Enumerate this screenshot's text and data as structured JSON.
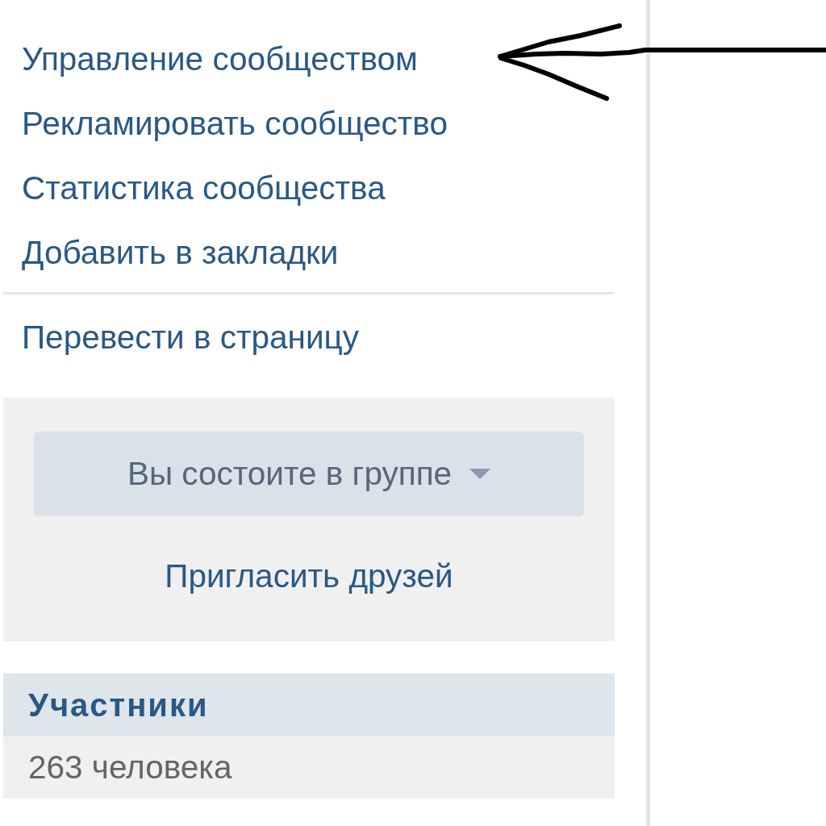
{
  "menu_groups": [
    {
      "items": [
        {
          "label": "Управление сообществом",
          "pointed": true
        },
        {
          "label": "Рекламировать сообщество",
          "pointed": false
        },
        {
          "label": "Статистика сообщества",
          "pointed": false
        },
        {
          "label": "Добавить в закладки",
          "pointed": false
        }
      ]
    },
    {
      "items": [
        {
          "label": "Перевести в страницу",
          "pointed": false
        }
      ]
    }
  ],
  "membership": {
    "button": "Вы состоите в группе",
    "invite_link": "Пригласить друзей"
  },
  "members": {
    "title": "Участники",
    "count": "263 человека"
  }
}
